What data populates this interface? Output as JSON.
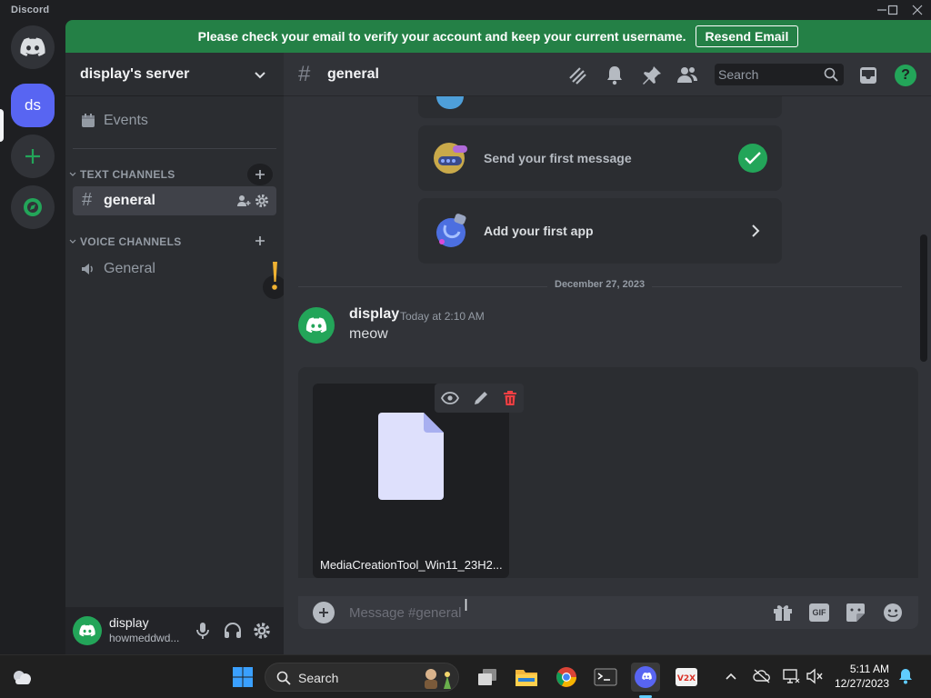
{
  "window": {
    "title": "Discord"
  },
  "banner": {
    "message": "Please check your email to verify your account and keep your current username.",
    "button": "Resend Email"
  },
  "rail": {
    "server_initials": "ds"
  },
  "sidebar": {
    "server_name": "display's server",
    "events_label": "Events",
    "text_category": "TEXT CHANNELS",
    "voice_category": "VOICE CHANNELS",
    "text_channels": [
      {
        "name": "general",
        "selected": true
      }
    ],
    "voice_channels": [
      {
        "name": "General"
      }
    ]
  },
  "user_panel": {
    "display_name": "display",
    "status": "howmeddwd..."
  },
  "chat": {
    "channel_name": "general",
    "search_placeholder": "Search",
    "onboarding": [
      {
        "label": "Send your first message",
        "done": true
      },
      {
        "label": "Add your first app",
        "done": false
      }
    ],
    "date_divider": "December 27, 2023",
    "message": {
      "author": "display",
      "timestamp": "Today at 2:10 AM",
      "content": "meow"
    },
    "attachment": {
      "filename": "MediaCreationTool_Win11_23H2..."
    },
    "composer_placeholder": "Message #general"
  },
  "taskbar": {
    "search_label": "Search",
    "time": "5:11 AM",
    "date": "12/27/2023"
  },
  "colors": {
    "accent": "#5865f2",
    "success": "#23a559",
    "banner": "#248046",
    "danger": "#f23f43",
    "warning": "#f0b232"
  }
}
